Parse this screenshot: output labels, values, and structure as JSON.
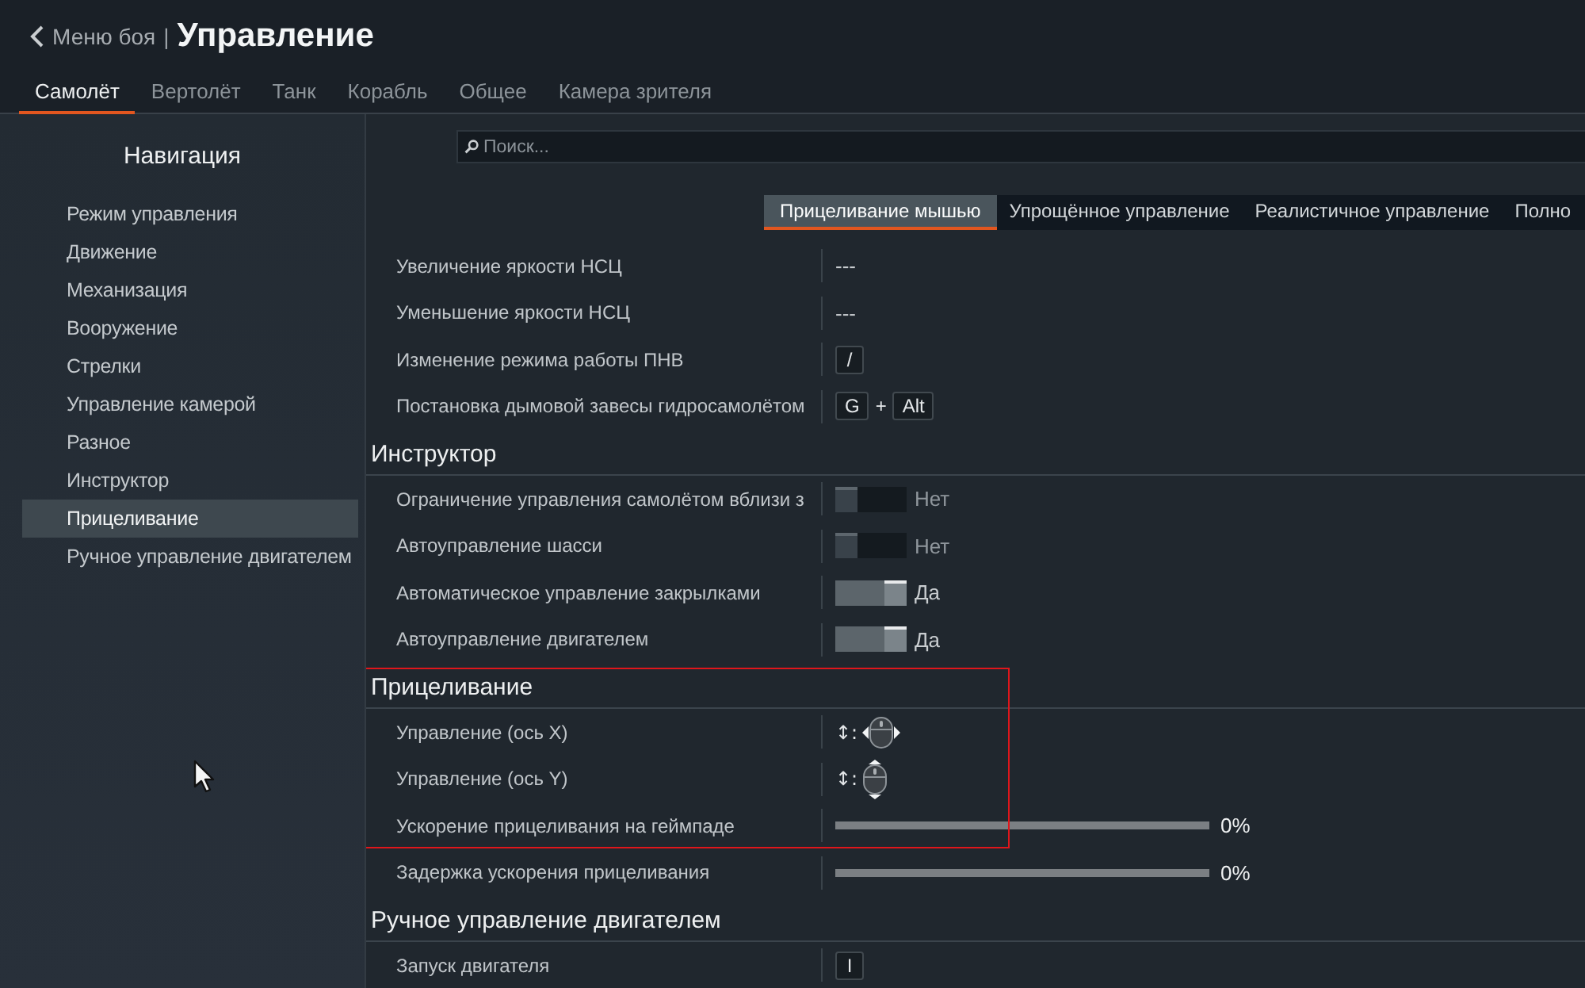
{
  "header": {
    "back_label": "Меню боя",
    "separator": "|",
    "title": "Управление"
  },
  "tabs": [
    {
      "label": "Самолёт",
      "selected": true
    },
    {
      "label": "Вертолёт",
      "selected": false
    },
    {
      "label": "Танк",
      "selected": false
    },
    {
      "label": "Корабль",
      "selected": false
    },
    {
      "label": "Общее",
      "selected": false
    },
    {
      "label": "Камера зрителя",
      "selected": false
    }
  ],
  "navigation": {
    "title": "Навигация",
    "items": [
      {
        "label": "Режим управления",
        "selected": false
      },
      {
        "label": "Движение",
        "selected": false
      },
      {
        "label": "Механизация",
        "selected": false
      },
      {
        "label": "Вооружение",
        "selected": false
      },
      {
        "label": "Стрелки",
        "selected": false
      },
      {
        "label": "Управление камерой",
        "selected": false
      },
      {
        "label": "Разное",
        "selected": false
      },
      {
        "label": "Инструктор",
        "selected": false
      },
      {
        "label": "Прицеливание",
        "selected": true
      },
      {
        "label": "Ручное управление двигателем",
        "selected": false
      }
    ]
  },
  "search": {
    "placeholder": "Поиск..."
  },
  "mode_tabs": [
    {
      "label": "Прицеливание мышью",
      "selected": true
    },
    {
      "label": "Упрощённое управление",
      "selected": false
    },
    {
      "label": "Реалистичное управление",
      "selected": false
    },
    {
      "label": "Полно",
      "selected": false
    }
  ],
  "sections": [
    {
      "highlighted": false,
      "rows": [
        {
          "label": "Увеличение яркости НСЦ",
          "kind": "text",
          "text": "---"
        },
        {
          "label": "Уменьшение яркости НСЦ",
          "kind": "text",
          "text": "---"
        },
        {
          "label": "Изменение режима работы ПНВ",
          "kind": "keys",
          "keys": [
            "/"
          ]
        },
        {
          "label": "Постановка дымовой завесы гидросамолётом",
          "kind": "keys",
          "keys": [
            "G",
            "Alt"
          ],
          "joiner": "+"
        }
      ]
    },
    {
      "title": "Инструктор",
      "highlighted": false,
      "rows": [
        {
          "label": "Ограничение управления самолётом вблизи з",
          "kind": "toggle",
          "on": false,
          "text": "Нет"
        },
        {
          "label": "Автоуправление шасси",
          "kind": "toggle",
          "on": false,
          "text": "Нет"
        },
        {
          "label": "Автоматическое управление закрылками",
          "kind": "toggle",
          "on": true,
          "text": "Да"
        },
        {
          "label": "Автоуправление двигателем",
          "kind": "toggle",
          "on": true,
          "text": "Да"
        }
      ]
    },
    {
      "title": "Прицеливание",
      "highlighted": true,
      "rows": [
        {
          "label": "Управление (ось X)",
          "kind": "mouse_x",
          "text": "↕:",
          "highlighted": true
        },
        {
          "label": "Управление (ось Y)",
          "kind": "mouse_y",
          "text": "↕:",
          "highlighted": true
        },
        {
          "label": "Ускорение прицеливания на геймпаде",
          "kind": "slider",
          "level": 0,
          "reading": "0%",
          "highlighted": true
        },
        {
          "label": "Задержка ускорения прицеливания",
          "kind": "slider",
          "level": 0,
          "reading": "0%",
          "highlighted": false
        }
      ]
    },
    {
      "title": "Ручное управление двигателем",
      "highlighted": false,
      "rows": [
        {
          "label": "Запуск двигателя",
          "kind": "keys",
          "keys": [
            "I"
          ]
        }
      ]
    }
  ]
}
